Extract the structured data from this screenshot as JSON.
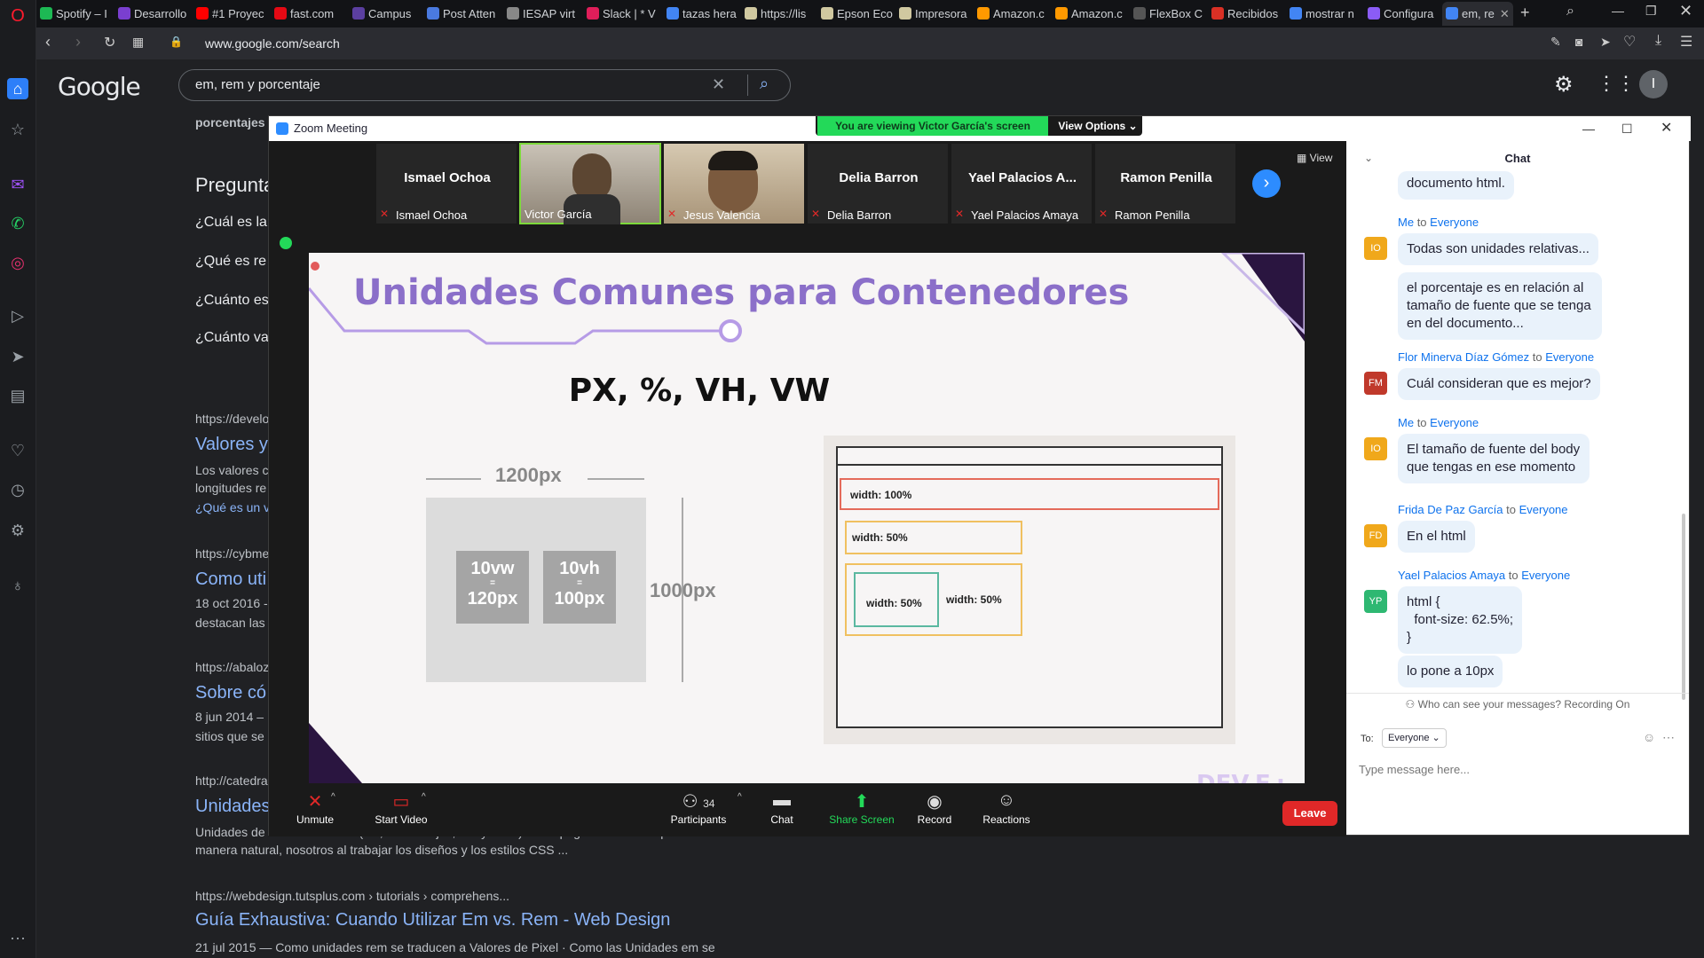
{
  "browser": {
    "tabs": [
      {
        "label": "Spotify – I",
        "color": "#1db954"
      },
      {
        "label": "Desarrollo",
        "color": "#7a3fd0"
      },
      {
        "label": "#1 Proyec",
        "color": "#ff0000"
      },
      {
        "label": "fast.com",
        "color": "#e50914"
      },
      {
        "label": "Campus",
        "color": "#5b3fa0"
      },
      {
        "label": "Post Atten",
        "color": "#4a7ae0"
      },
      {
        "label": "IESAP virt",
        "color": "#888888"
      },
      {
        "label": "Slack | * V",
        "color": "#e01e5a"
      },
      {
        "label": "tazas hera",
        "color": "#4285f4"
      },
      {
        "label": "https://lis",
        "color": "#d0c8a0"
      },
      {
        "label": "Epson Eco",
        "color": "#d0c8a0"
      },
      {
        "label": "Impresora",
        "color": "#d0c8a0"
      },
      {
        "label": "Amazon.c",
        "color": "#ff9900"
      },
      {
        "label": "Amazon.c",
        "color": "#ff9900"
      },
      {
        "label": "FlexBox C",
        "color": "#555555"
      },
      {
        "label": "Recibidos",
        "color": "#d93025"
      },
      {
        "label": "mostrar n",
        "color": "#4285f4"
      },
      {
        "label": "Configura",
        "color": "#8b5cf6"
      },
      {
        "label": "em, re",
        "color": "#4285f4"
      }
    ],
    "url": "www.google.com/search"
  },
  "google": {
    "logo": "Google",
    "query": "em, rem y porcentaje",
    "top_snippet": "porcentajes",
    "preguntas_heading": "Pregunta",
    "questions": [
      "¿Cuál es la",
      "¿Qué es re",
      "¿Cuánto es",
      "¿Cuánto va"
    ],
    "results": [
      {
        "url": "https://develo",
        "title": "Valores y",
        "snippet1": "Los valores c",
        "snippet2": "longitudes re",
        "snippet3": "¿Qué es un v"
      },
      {
        "url": "https://cybme",
        "title": "Como uti",
        "snippet1": "18 oct 2016 -",
        "snippet2": "destacan las"
      },
      {
        "url": "https://abaloz",
        "title": "Sobre có",
        "snippet1": "8 jun 2014 –",
        "snippet2": "sitios que se"
      },
      {
        "url": "http://catedra",
        "title": "Unidades",
        "snippet1": "Unidades de medida en CSS (PX, Porcentajes, EM y REM). Toda página web es responsive de",
        "snippet2": "manera natural, nosotros al trabajar los diseños y los estilos CSS ..."
      },
      {
        "url": "https://webdesign.tutsplus.com › tutorials › comprehens...",
        "title": "Guía Exhaustiva: Cuando Utilizar Em vs. Rem - Web Design",
        "snippet1": "21 jul 2015 — Como unidades rem se traducen a Valores de Pixel · Como las Unidades em se"
      }
    ]
  },
  "zoom": {
    "window_title": "Zoom Meeting",
    "viewing_banner": "You are viewing Victor García's screen",
    "view_options": "View Options",
    "view_label": "View",
    "participants": [
      {
        "name": "Ismael Ochoa",
        "label": "Ismael Ochoa",
        "has_video": false
      },
      {
        "name": "",
        "label": "Victor García",
        "has_video": true
      },
      {
        "name": "",
        "label": "Jesus Valencia",
        "has_video": true
      },
      {
        "name": "Delia Barron",
        "label": "Delia Barron",
        "has_video": false
      },
      {
        "name": "Yael Palacios A...",
        "label": "Yael Palacios Amaya",
        "has_video": false
      },
      {
        "name": "Ramon Penilla",
        "label": "Ramon Penilla",
        "has_video": false
      }
    ],
    "slide": {
      "title": "Unidades Comunes para Contenedores",
      "subtitle": "PX, %, VH, VW",
      "width_label": "1200px",
      "height_label": "1000px",
      "vw_line1": "10vw",
      "vw_line2": "=",
      "vw_line3": "120px",
      "vh_line1": "10vh",
      "vh_line2": "=",
      "vh_line3": "100px",
      "box_100": "width: 100%",
      "box_50a": "width: 50%",
      "box_50b": "width: 50%",
      "box_50c": "width: 50%",
      "brand": "DEV.F.:"
    },
    "toolbar": {
      "unmute": "Unmute",
      "start_video": "Start Video",
      "participants": "Participants",
      "participants_count": "34",
      "chat": "Chat",
      "share_screen": "Share Screen",
      "record": "Record",
      "reactions": "Reactions",
      "leave": "Leave"
    },
    "chat": {
      "header": "Chat",
      "messages": [
        {
          "text": "documento html."
        },
        {
          "from": "Me",
          "to": "Everyone",
          "initials": "IO",
          "color": "#f0a81b",
          "text": "Todas son unidades relativas..."
        },
        {
          "text": "el porcentaje es en relación al tamaño de fuente que se tenga en del documento..."
        },
        {
          "from": "Flor Minerva Díaz Gómez",
          "to": "Everyone",
          "initials": "FM",
          "color": "#c0392b",
          "text": "Cuál consideran que es mejor?"
        },
        {
          "from": "Me",
          "to": "Everyone",
          "initials": "IO",
          "color": "#f0a81b",
          "text": "El tamaño de fuente del body que tengas en ese momento"
        },
        {
          "from": "Frida De Paz García",
          "to": "Everyone",
          "initials": "FD",
          "color": "#f0a81b",
          "text": "En el html"
        },
        {
          "from": "Yael Palacios Amaya",
          "to": "Everyone",
          "initials": "YP",
          "color": "#2eb872",
          "text": "html {\n  font-size: 62.5%;\n}"
        },
        {
          "text": "lo pone a 10px"
        }
      ],
      "to_word": "to",
      "privacy": "Who can see your messages? Recording On",
      "to_label": "To:",
      "recipient": "Everyone",
      "input_placeholder": "Type message here..."
    }
  }
}
